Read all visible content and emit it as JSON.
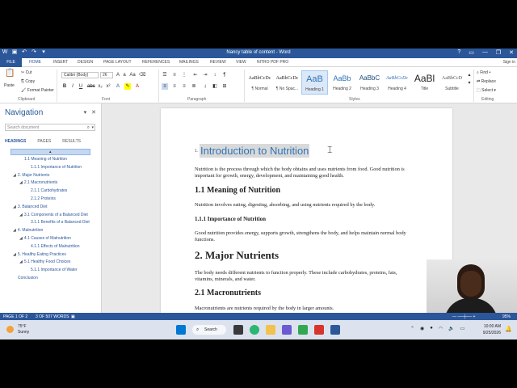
{
  "window": {
    "title": "Nancy table of content - Word",
    "help": "?",
    "controls": [
      "▭",
      "—",
      "❐",
      "✕"
    ]
  },
  "ribbon_tabs": [
    "FILE",
    "HOME",
    "INSERT",
    "DESIGN",
    "PAGE LAYOUT",
    "REFERENCES",
    "MAILINGS",
    "REVIEW",
    "VIEW",
    "NITRO PDF PRO"
  ],
  "sign_in": "Sign in",
  "ribbon": {
    "paste": "Paste",
    "cut": "Cut",
    "copy": "Copy",
    "format_painter": "Format Painter",
    "clipboard_label": "Clipboard",
    "font_name": "Calibri (Body)",
    "font_size": "26",
    "font_label": "Font",
    "paragraph_label": "Paragraph",
    "styles_label": "Styles",
    "editing_label": "Editing",
    "find": "Find",
    "replace": "Replace",
    "select": "Select",
    "styles": [
      {
        "sample": "AaBbCcDc",
        "name": "¶ Normal"
      },
      {
        "sample": "AaBbCcDc",
        "name": "¶ No Spac..."
      },
      {
        "sample": "AaB",
        "name": "Heading 1"
      },
      {
        "sample": "AaBb",
        "name": "Heading 2"
      },
      {
        "sample": "AaBbC",
        "name": "Heading 3"
      },
      {
        "sample": "AaBbCcDc",
        "name": "Heading 4"
      },
      {
        "sample": "AaBl",
        "name": "Title"
      },
      {
        "sample": "AaBbCcD",
        "name": "Subtitle"
      }
    ]
  },
  "navigation": {
    "title": "Navigation",
    "search_placeholder": "Search document",
    "tabs": [
      "HEADINGS",
      "PAGES",
      "RESULTS"
    ],
    "items": [
      {
        "label": "1.1 Meaning of Nutrition",
        "level": 2,
        "expandable": false
      },
      {
        "label": "1.1.1 Importance of Nutrition",
        "level": 3,
        "expandable": false
      },
      {
        "label": "2. Major Nutrients",
        "level": 1,
        "expandable": true
      },
      {
        "label": "2.1 Macronutrients",
        "level": 2,
        "expandable": true
      },
      {
        "label": "2.1.1 Carbohydrates",
        "level": 3,
        "expandable": false
      },
      {
        "label": "2.1.2 Proteins",
        "level": 3,
        "expandable": false
      },
      {
        "label": "3. Balanced Diet",
        "level": 1,
        "expandable": true
      },
      {
        "label": "3.1 Components of a Balanced Diet",
        "level": 2,
        "expandable": true
      },
      {
        "label": "3.1.1 Benefits of a Balanced Diet",
        "level": 3,
        "expandable": false
      },
      {
        "label": "4. Malnutrition",
        "level": 1,
        "expandable": true
      },
      {
        "label": "4.1 Causes of Malnutrition",
        "level": 2,
        "expandable": true
      },
      {
        "label": "4.1.1 Effects of Malnutrition",
        "level": 3,
        "expandable": false
      },
      {
        "label": "5. Healthy Eating Practices",
        "level": 1,
        "expandable": true
      },
      {
        "label": "5.1 Healthy Food Choices",
        "level": 2,
        "expandable": true
      },
      {
        "label": "5.1.1 Importance of Water",
        "level": 3,
        "expandable": false
      },
      {
        "label": "Conclusion",
        "level": 1,
        "expandable": false
      }
    ]
  },
  "document": {
    "h1_number": "1.",
    "h1_title": "Introduction to Nutrition",
    "p1": "Nutrition is the process through which the body obtains and uses nutrients from food. Good nutrition is important for growth, energy, development, and maintaining good health.",
    "h2_1": "1.1 Meaning of Nutrition",
    "p2": "Nutrition involves eating, digesting, absorbing, and using nutrients required by the body.",
    "h3_1": "1.1.1 Importance of Nutrition",
    "p3": "Good nutrition provides energy, supports growth, strengthens the body, and helps maintain normal body functions.",
    "h1_2": "2. Major Nutrients",
    "p4": "The body needs different nutrients to function properly. These include carbohydrates, proteins, fats, vitamins, minerals, and water.",
    "h2_2": "2.1 Macronutrients",
    "p5": "Macronutrients are nutrients required by the body in larger amounts."
  },
  "status_bar": {
    "page": "PAGE 1 OF 2",
    "words": "3 OF 507 WORDS",
    "zoom": "95%"
  },
  "taskbar": {
    "temp": "75°F",
    "weather": "Sunny",
    "search": "Search",
    "time": "10:00 AM",
    "date": "9/25/2026"
  },
  "colors": {
    "word_blue": "#2b579a",
    "heading_blue": "#2e74b5"
  }
}
